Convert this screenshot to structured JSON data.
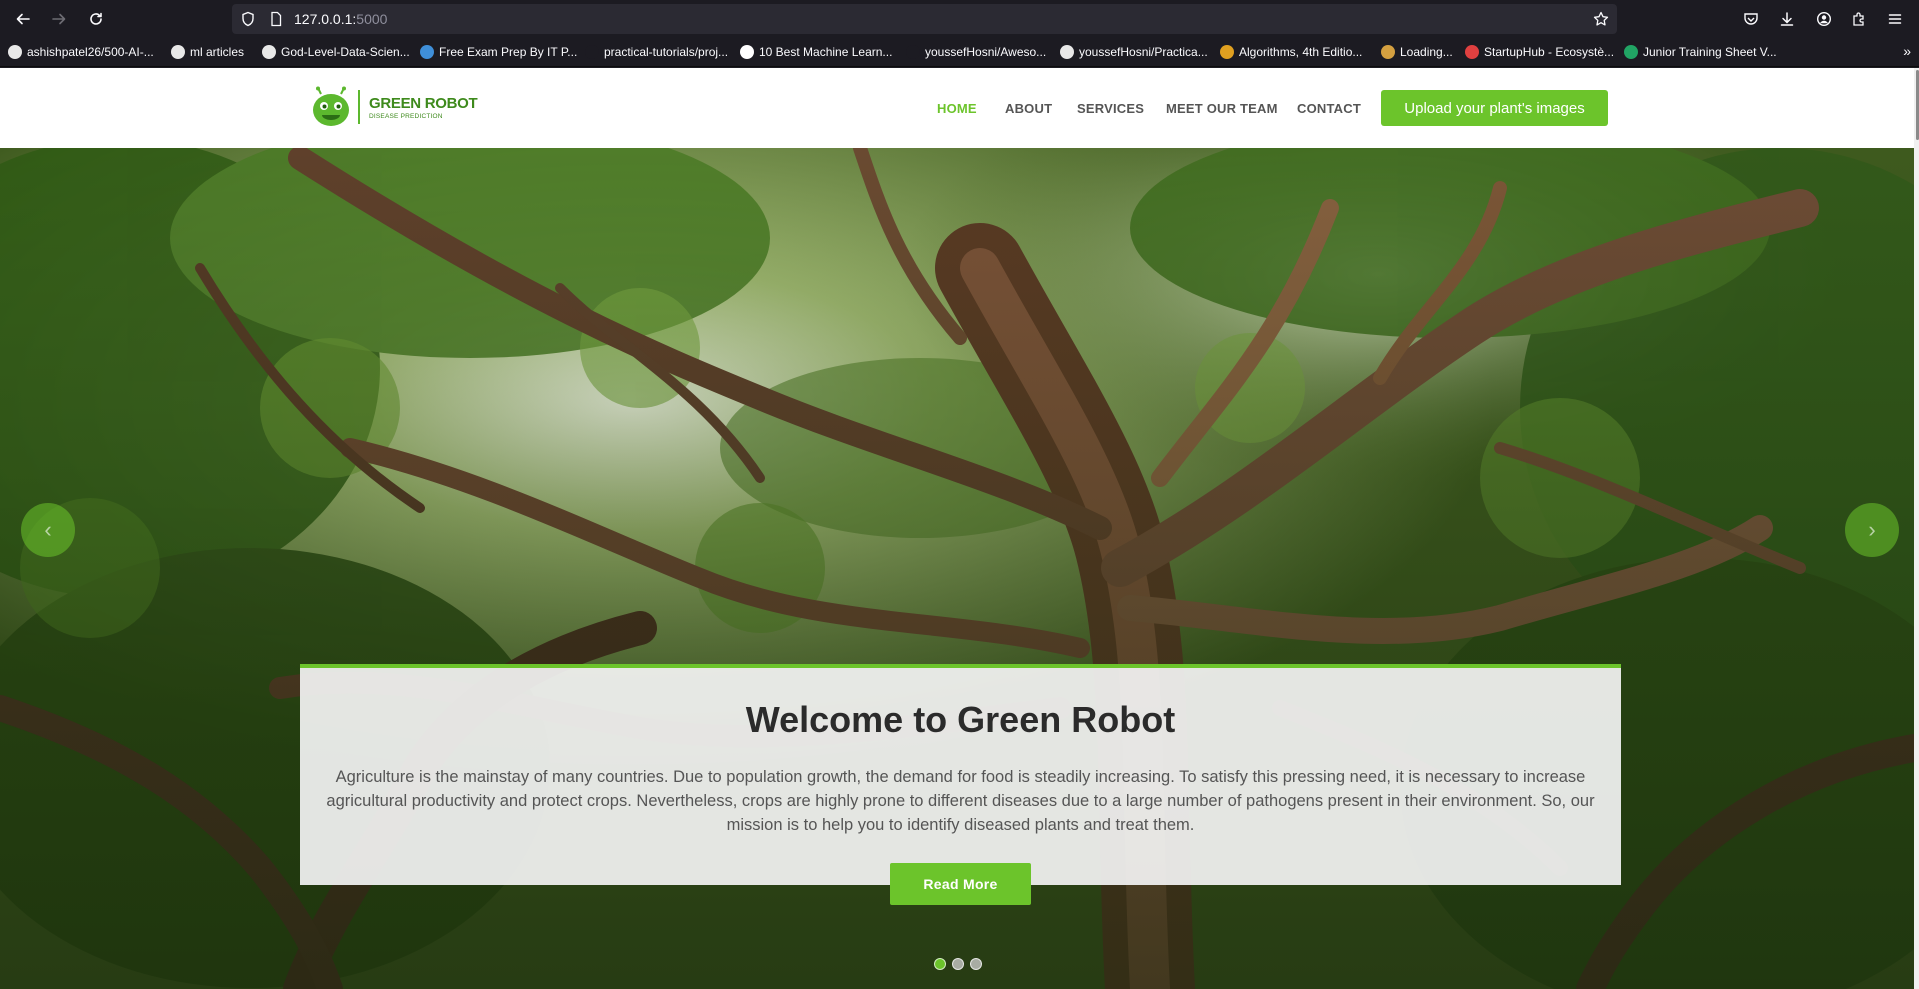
{
  "browser": {
    "url_host": "127.0.0.1:",
    "url_port": "5000",
    "bookmarks": [
      {
        "label": "ashishpatel26/500-AI-...",
        "icon": "github-icon",
        "color": "#e8e8e8"
      },
      {
        "label": "ml articles",
        "icon": "github-icon",
        "color": "#e8e8e8"
      },
      {
        "label": "God-Level-Data-Scien...",
        "icon": "github-icon",
        "color": "#e8e8e8"
      },
      {
        "label": "Free Exam Prep By IT P...",
        "icon": "exam-prep-icon",
        "color": "#3f8fd9"
      },
      {
        "label": "practical-tutorials/proj...",
        "icon": "blank-icon",
        "color": "#1c1b22"
      },
      {
        "label": "10 Best Machine Learn...",
        "icon": "medium-icon",
        "color": "#ffffff"
      },
      {
        "label": "youssefHosni/Aweso...",
        "icon": "blank-icon",
        "color": "#1c1b22"
      },
      {
        "label": "youssefHosni/Practica...",
        "icon": "github-icon",
        "color": "#e8e8e8"
      },
      {
        "label": "Algorithms, 4th Editio...",
        "icon": "algorithms-icon",
        "color": "#e0a020"
      },
      {
        "label": "Loading...",
        "icon": "loading-icon",
        "color": "#d4a040"
      },
      {
        "label": "StartupHub - Ecosystè...",
        "icon": "rocket-icon",
        "color": "#e04040"
      },
      {
        "label": "Junior Training Sheet V...",
        "icon": "sheets-icon",
        "color": "#21a464"
      }
    ]
  },
  "site": {
    "logo_name": "GREEN ROBOT",
    "logo_sub": "DISEASE PREDICTION",
    "nav": [
      {
        "label": "HOME",
        "active": true
      },
      {
        "label": "ABOUT",
        "active": false
      },
      {
        "label": "SERVICES",
        "active": false
      },
      {
        "label": "MEET OUR TEAM",
        "active": false
      },
      {
        "label": "CONTACT",
        "active": false
      }
    ],
    "upload_label": "Upload your plant's images",
    "accent": "#6cc42b"
  },
  "hero": {
    "title": "Welcome to Green Robot",
    "text": "Agriculture is the mainstay of many countries. Due to population growth, the demand for food is steadily increasing. To satisfy this pressing need, it is necessary to increase agricultural productivity and protect crops. Nevertheless, crops are highly prone to different diseases due to a large number of pathogens present in their environment. So, our mission is to help you to identify diseased plants and treat them.",
    "read_more": "Read More",
    "slide_count": 3,
    "active_slide": 1
  }
}
